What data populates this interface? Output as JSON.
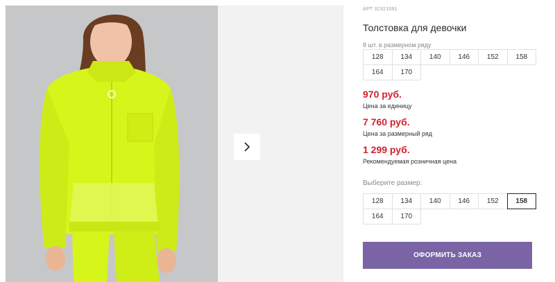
{
  "product": {
    "article_label": "АРТ",
    "article_number": "32321091",
    "title": "Толстовка для девочки",
    "pack_note": "8 шт. в размерном ряду"
  },
  "gallery": {
    "next_icon": "chevron-right-icon"
  },
  "size_range": [
    "128",
    "134",
    "140",
    "146",
    "152",
    "158",
    "164",
    "170"
  ],
  "prices": [
    {
      "value": "970 руб.",
      "label": "Цена за единицу"
    },
    {
      "value": "7 760 руб.",
      "label": "Цена за размерный ряд"
    },
    {
      "value": "1 299 руб.",
      "label": "Рекомендуемая розничная цена"
    }
  ],
  "size_select": {
    "label": "Выберите размер:",
    "options": [
      "128",
      "134",
      "140",
      "146",
      "152",
      "158",
      "164",
      "170"
    ],
    "selected": "158"
  },
  "order_button": {
    "label": "ОФОРМИТЬ ЗАКАЗ"
  },
  "colors": {
    "price": "#d21f2f",
    "order_button": "#7b64a6",
    "jacket": "#d6f51a"
  }
}
